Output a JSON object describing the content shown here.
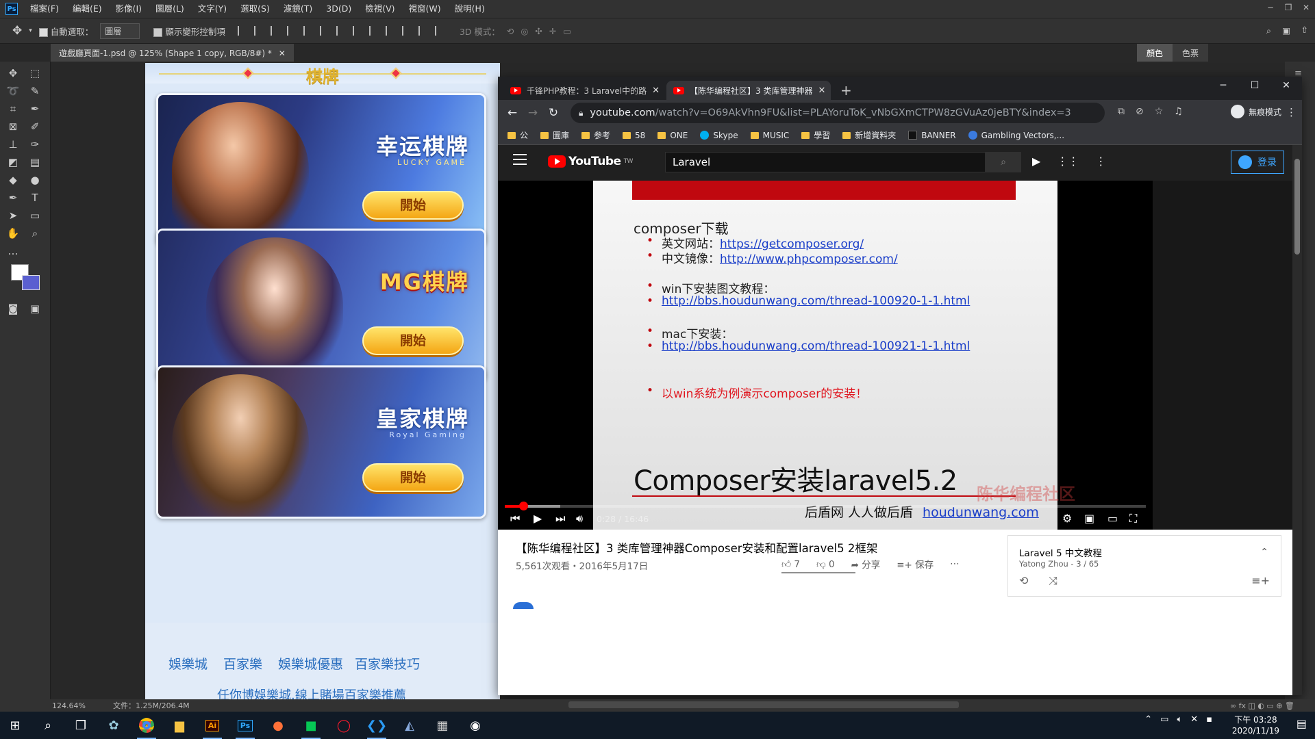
{
  "ps": {
    "menu": [
      "檔案(F)",
      "編輯(E)",
      "影像(I)",
      "圖層(L)",
      "文字(Y)",
      "選取(S)",
      "濾鏡(T)",
      "3D(D)",
      "檢視(V)",
      "視窗(W)",
      "說明(H)"
    ],
    "options": {
      "auto_select_label": "自動選取：",
      "auto_select_value": "圖層",
      "transform_label": "顯示變形控制項",
      "mode3d_label": "3D 模式："
    },
    "doc_tab": "遊戲廳頁面-1.psd @ 125% (Shape 1 copy, RGB/8#) *",
    "panel_tabs": [
      "顏色",
      "色票"
    ],
    "status_zoom": "124.64%",
    "status_doc": "文件：1.25M/206.4M"
  },
  "doc": {
    "title": "棋牌",
    "cards": [
      {
        "logo": "幸运棋牌",
        "logo_sub": "LUCKY GAME",
        "button": "開始"
      },
      {
        "logo": "MG棋牌",
        "logo_sub": "",
        "button": "開始"
      },
      {
        "logo": "皇家棋牌",
        "logo_sub": "Royal Gaming",
        "button": "開始"
      }
    ],
    "footer_links": [
      "娛樂城",
      "百家樂",
      "娛樂城優惠",
      "百家樂技巧"
    ],
    "footer_tagline": "任你博娛樂城.線上賭場百家樂推薦"
  },
  "chrome": {
    "tabs": [
      {
        "title": "千锋PHP教程：3 Laravel中的路"
      },
      {
        "title": "【陈华编程社区】3 类库管理神器"
      }
    ],
    "url_host": "youtube.com",
    "url_path": "/watch?v=O69AkVhn9FU&list=PLAYoruToK_vNbGXmCTPW8zGVuAz0jeBTY&index=3",
    "incognito_label": "無痕模式",
    "bookmarks": [
      "公",
      "圖庫",
      "参考",
      "58",
      "ONE",
      "Skype",
      "MUSIC",
      "學習",
      "新增資料夾",
      "BANNER",
      "Gambling Vectors,..."
    ]
  },
  "youtube": {
    "logo_text": "YouTube",
    "logo_region": "TW",
    "search_value": "Laravel",
    "signin_label": "登录",
    "slide": {
      "heading": "composer下载",
      "en_site_label": "英文网站：",
      "en_site_url": "https://getcomposer.org/",
      "cn_mirror_label": "中文镜像：",
      "cn_mirror_url": "http://www.phpcomposer.com/",
      "win_label": "win下安装图文教程：",
      "win_url": "http://bbs.houdunwang.com/thread-100920-1-1.html",
      "mac_label": "mac下安装：",
      "mac_url": "http://bbs.houdunwang.com/thread-100921-1-1.html",
      "note": "以win系统为例演示composer的安装！",
      "title": "Composer安装laravel5.2",
      "footer_text": "后盾网 人人做后盾",
      "footer_url": "houdunwang.com",
      "watermark": "陈华编程社区"
    },
    "player": {
      "time": "0:28 / 16:46",
      "played_fraction": 0.029,
      "loaded_fraction": 0.087
    },
    "video_title": "【陈华编程社区】3 类库管理神器Composer安装和配置laravel5 2框架",
    "views_date": "5,561次观看・2016年5月17日",
    "likes": "7",
    "dislikes": "0",
    "share_label": "分享",
    "save_label": "保存",
    "playlist": {
      "title": "Laravel 5 中文教程",
      "sub": "Yatong Zhou - 3 / 65"
    }
  },
  "taskbar": {
    "time": "下午 03:28",
    "date": "2020/11/19"
  }
}
